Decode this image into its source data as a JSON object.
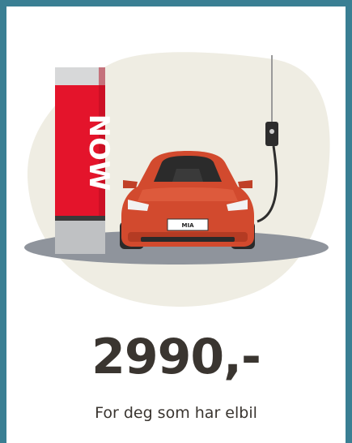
{
  "card": {
    "brand_label": "NOW",
    "plate_text": "MIA",
    "price": "2990,-",
    "subtitle": "For deg som har elbil"
  },
  "colors": {
    "frame": "#3a7f93",
    "blob": "#efede3",
    "station_red": "#e4142b",
    "car_body": "#d24a2e",
    "ground": "#8f949c",
    "text": "#3a3530"
  },
  "icons": {
    "illustration": "ev-charging-car-illustration"
  }
}
